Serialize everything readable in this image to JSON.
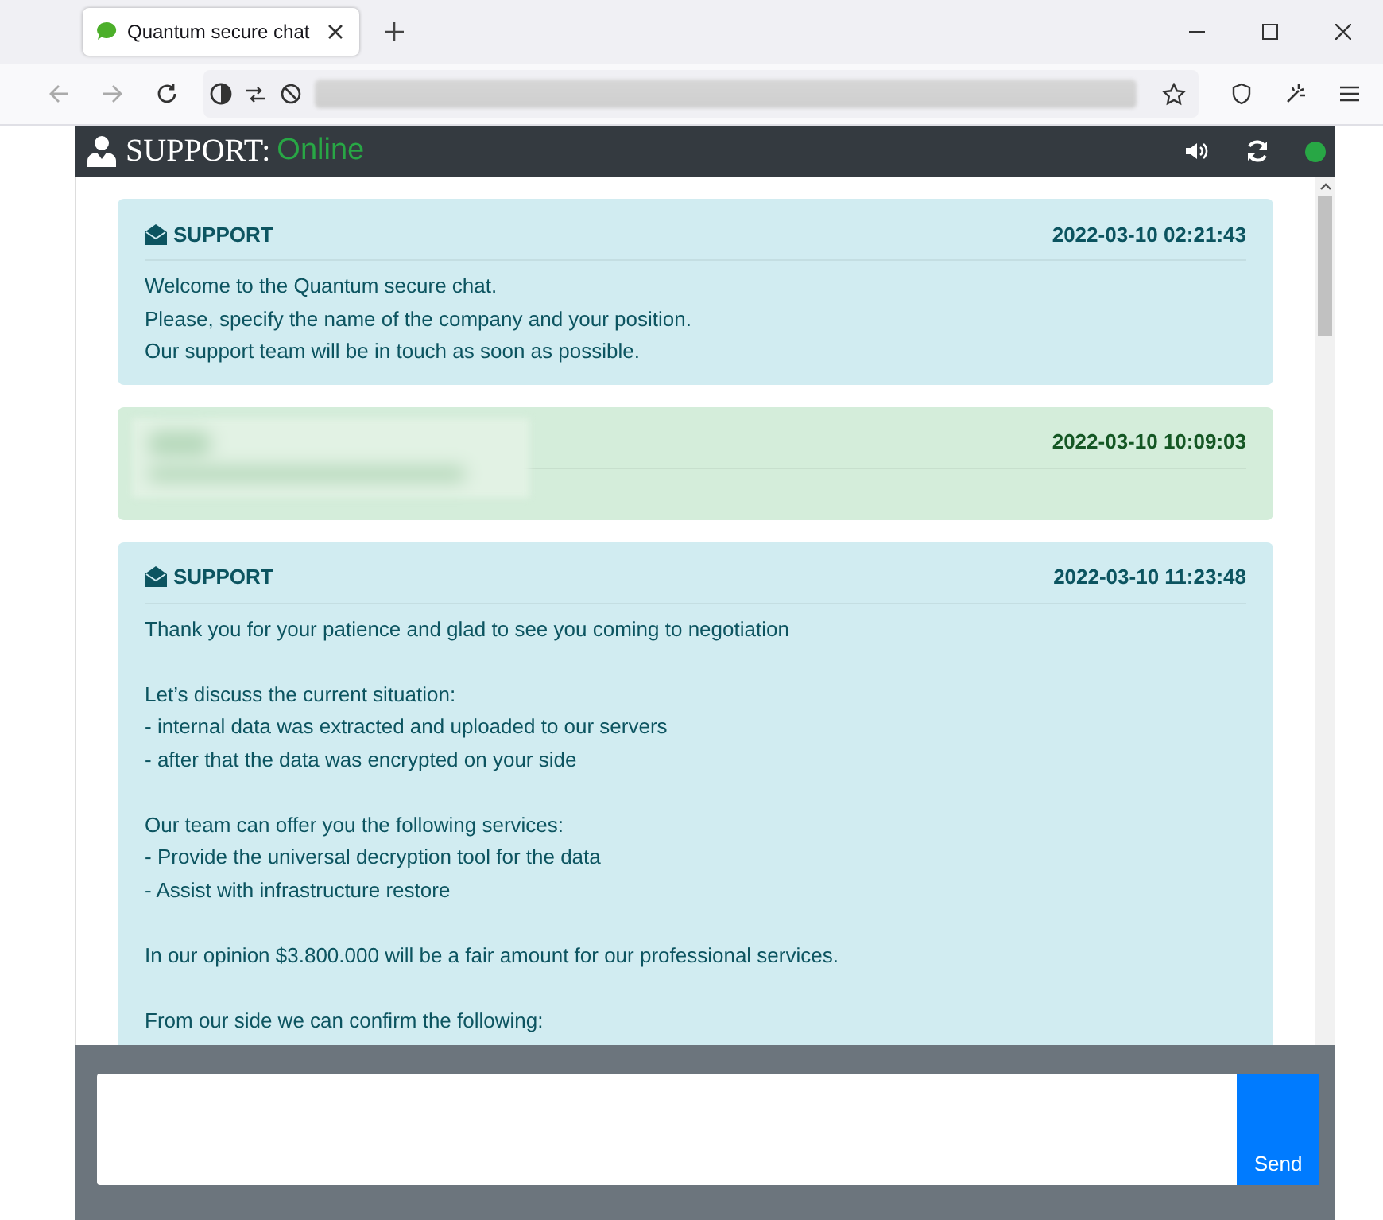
{
  "browser": {
    "tab_title": "Quantum secure chat"
  },
  "chat": {
    "title": "SUPPORT:",
    "status": "Online",
    "online": true,
    "messages": [
      {
        "kind": "support",
        "sender": "SUPPORT",
        "time": "2022-03-10 02:21:43",
        "paragraphs": [
          [
            "Welcome to the Quantum secure chat.",
            "Please, specify the name of the company and your position.",
            "Our support team will be in touch as soon as possible."
          ]
        ]
      },
      {
        "kind": "client",
        "time": "2022-03-10 10:09:03",
        "redacted": true
      },
      {
        "kind": "support",
        "sender": "SUPPORT",
        "time": "2022-03-10 11:23:48",
        "paragraphs": [
          [
            "Thank you for your patience and glad to see you coming to negotiation"
          ],
          [
            "Let’s discuss the current situation:",
            "- internal data was extracted and uploaded to our servers",
            "- after that the data was encrypted on your side"
          ],
          [
            "Our team can offer you the following services:",
            "- Provide the universal decryption tool for the data",
            "- Assist with infrastructure restore"
          ],
          [
            "In our opinion $3.800.000 will be a fair amount for our professional services."
          ],
          [
            "From our side we can confirm the following:"
          ]
        ]
      }
    ],
    "send_button": "Send"
  }
}
